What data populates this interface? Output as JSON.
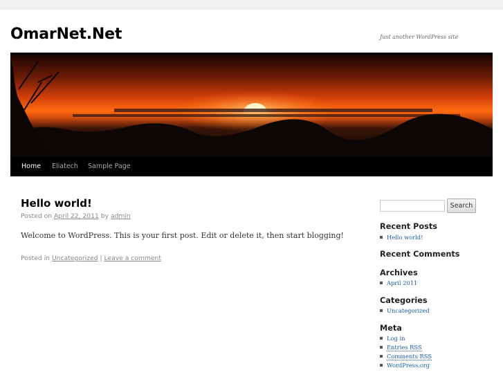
{
  "site": {
    "title": "OmarNet.Net",
    "description": "Just another WordPress site"
  },
  "nav": {
    "items": [
      {
        "label": "Home"
      },
      {
        "label": "Eliatech"
      },
      {
        "label": "Sample Page"
      }
    ]
  },
  "post": {
    "title": "Hello world!",
    "meta_prefix": "Posted on",
    "date": "April 22, 2011",
    "meta_by": "by",
    "author": "admin",
    "content": "Welcome to WordPress. This is your first post. Edit or delete it, then start blogging!",
    "utility_prefix": "Posted in",
    "category": "Uncategorized",
    "separator": "|",
    "comment_link": "Leave a comment"
  },
  "sidebar": {
    "search": {
      "value": "",
      "button_label": "Search"
    },
    "recent_posts": {
      "title": "Recent Posts",
      "items": [
        "Hello world!"
      ]
    },
    "recent_comments": {
      "title": "Recent Comments"
    },
    "archives": {
      "title": "Archives",
      "items": [
        "April 2011"
      ]
    },
    "categories": {
      "title": "Categories",
      "items": [
        "Uncategorized"
      ]
    },
    "meta": {
      "title": "Meta",
      "items": [
        "Log in",
        "Entries RSS",
        "Comments RSS",
        "WordPress.org"
      ]
    }
  },
  "colors": {
    "link": "#1b5aa6",
    "nav_background": "#000000",
    "page_background": "#f1f1f1"
  }
}
